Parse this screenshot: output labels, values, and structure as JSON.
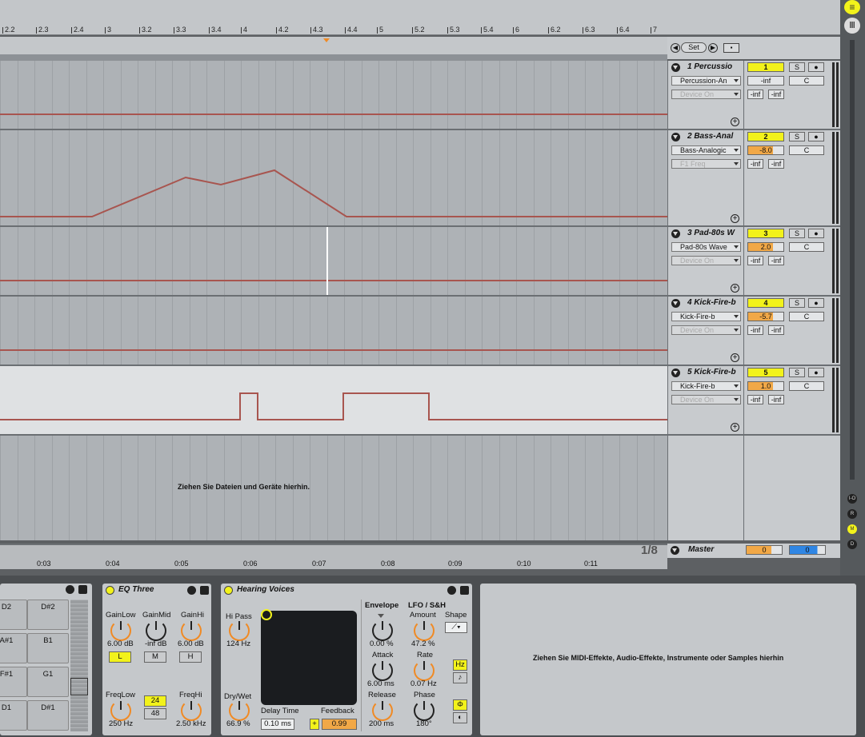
{
  "ruler": {
    "ticks": [
      "2.2",
      "2.3",
      "2.4",
      "3",
      "3.2",
      "3.3",
      "3.4",
      "4",
      "4.2",
      "4.3",
      "4.4",
      "5",
      "5.2",
      "5.3",
      "5.4",
      "6",
      "6.2",
      "6.3",
      "6.4",
      "7"
    ]
  },
  "locator": {
    "set_label": "Set"
  },
  "tracks": [
    {
      "name": "1 Percussio",
      "device": "Percussion-An",
      "param": "Device On",
      "num": "1",
      "vol": "-inf",
      "pan": "C",
      "inL": "-inf",
      "inR": "-inf"
    },
    {
      "name": "2 Bass-Anal",
      "device": "Bass-Analogic",
      "param": "F1 Freq",
      "num": "2",
      "vol": "-8.0",
      "pan": "C",
      "inL": "-inf",
      "inR": "-inf"
    },
    {
      "name": "3 Pad-80s W",
      "device": "Pad-80s Wave",
      "param": "Device On",
      "num": "3",
      "vol": "2.0",
      "pan": "C",
      "inL": "-inf",
      "inR": "-inf"
    },
    {
      "name": "4 Kick-Fire-b",
      "device": "Kick-Fire-b",
      "param": "Device On",
      "num": "4",
      "vol": "-5.7",
      "pan": "C",
      "inL": "-inf",
      "inR": "-inf"
    },
    {
      "name": "5 Kick-Fire-b",
      "device": "Kick-Fire-b",
      "param": "Device On",
      "num": "5",
      "vol": "1.0",
      "pan": "C",
      "inL": "-inf",
      "inR": "-inf"
    }
  ],
  "drop_hint": "Ziehen Sie Dateien und Geräte hierhin.",
  "timeline": [
    "0:03",
    "0:04",
    "0:05",
    "0:06",
    "0:07",
    "0:08",
    "0:09",
    "0:10",
    "0:11"
  ],
  "zoom": "1/8",
  "master": {
    "name": "Master",
    "vol": "0",
    "pan": "0"
  },
  "side_buttons": [
    "I-O",
    "R",
    "M",
    "D"
  ],
  "drum_pads": [
    "D2",
    "D#2",
    "A#1",
    "B1",
    "F#1",
    "G1",
    "D1",
    "D#1"
  ],
  "eq": {
    "title": "EQ Three",
    "gain_low_label": "GainLow",
    "gain_mid_label": "GainMid",
    "gain_hi_label": "GainHi",
    "gain_low": "6.00 dB",
    "gain_mid": "-inf dB",
    "gain_hi": "6.00 dB",
    "l": "L",
    "m": "M",
    "h": "H",
    "freq_low_label": "FreqLow",
    "freq_hi_label": "FreqHi",
    "freq_low": "250 Hz",
    "freq_hi": "2.50 kHz",
    "slope_a": "24",
    "slope_b": "48"
  },
  "hv": {
    "title": "Hearing Voices",
    "hipass_label": "Hi Pass",
    "hipass": "124 Hz",
    "drywet_label": "Dry/Wet",
    "drywet": "66.9 %",
    "delay_label": "Delay Time",
    "delay": "0.10 ms",
    "feedback_label": "Feedback",
    "feedback": "0.99",
    "envelope_label": "Envelope",
    "env_val": "0.00 %",
    "attack_label": "Attack",
    "attack": "6.00 ms",
    "release_label": "Release",
    "release": "200 ms",
    "lfo_label": "LFO / S&H",
    "amount_label": "Amount",
    "amount": "47.2 %",
    "shape_label": "Shape",
    "rate_label": "Rate",
    "rate": "0.07 Hz",
    "hz": "Hz",
    "phase_label": "Phase",
    "phase": "180°",
    "phi": "Φ"
  },
  "device_drop_hint": "Ziehen Sie MIDI-Effekte, Audio-Effekte, Instrumente oder Samples hierhin",
  "colors": {
    "automation": "#a8554f",
    "selected": "#f2f21b",
    "volume": "#f1a847",
    "knob": "#f08a24"
  }
}
